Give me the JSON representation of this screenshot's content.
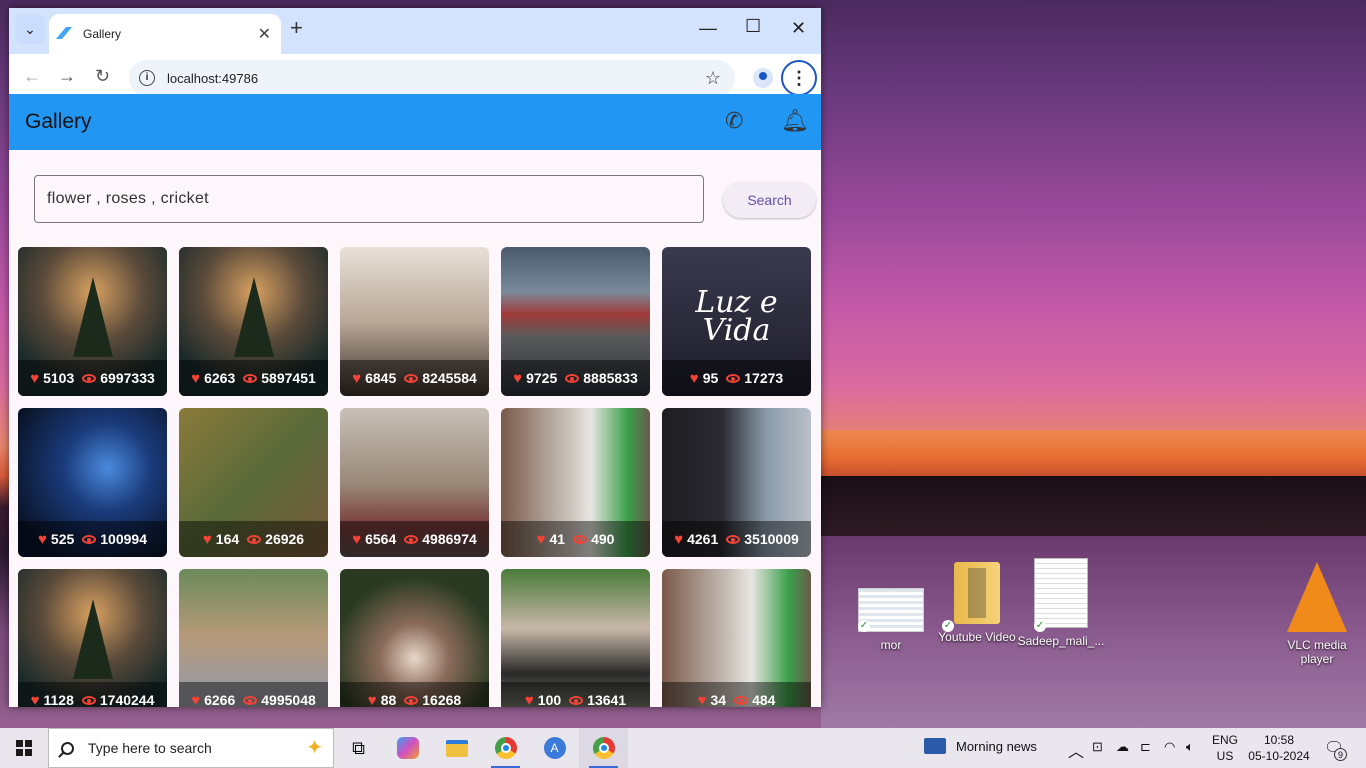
{
  "browser": {
    "tab_title": "Gallery",
    "url": "localhost:49786"
  },
  "app": {
    "title": "Gallery",
    "search_value": "flower , roses , cricket",
    "search_button": "Search"
  },
  "gallery": [
    {
      "likes": "5103",
      "views": "6997333",
      "image": "lake-tree"
    },
    {
      "likes": "6263",
      "views": "5897451",
      "image": "lake-tree"
    },
    {
      "likes": "6845",
      "views": "8245584",
      "image": "group-selfie"
    },
    {
      "likes": "9725",
      "views": "8885833",
      "image": "buildings"
    },
    {
      "likes": "95",
      "views": "17273",
      "image": "luz-e-vida"
    },
    {
      "likes": "525",
      "views": "100994",
      "image": "blue-flower"
    },
    {
      "likes": "164",
      "views": "26926",
      "image": "time-out"
    },
    {
      "likes": "6564",
      "views": "4986974",
      "image": "runner"
    },
    {
      "likes": "41",
      "views": "490",
      "image": "horse-girl"
    },
    {
      "likes": "4261",
      "views": "3510009",
      "image": "photographer"
    },
    {
      "likes": "1128",
      "views": "1740244",
      "image": "lake-tree"
    },
    {
      "likes": "6266",
      "views": "4995048",
      "image": "man-glasses"
    },
    {
      "likes": "88",
      "views": "16268",
      "image": "girl-flowers"
    },
    {
      "likes": "100",
      "views": "13641",
      "image": "samurai"
    },
    {
      "likes": "34",
      "views": "484",
      "image": "horse-girl"
    }
  ],
  "luz_text": "Luz e Vida",
  "desktop_icons": [
    {
      "label": "mor"
    },
    {
      "label": "Youtube Video"
    },
    {
      "label": "Sadeep_mali_..."
    },
    {
      "label": "VLC media player"
    }
  ],
  "taskbar": {
    "search_placeholder": "Type here to search",
    "news": "Morning news",
    "lang_top": "ENG",
    "lang_bottom": "US",
    "time": "10:58",
    "date": "05-10-2024",
    "notification_count": "9"
  }
}
